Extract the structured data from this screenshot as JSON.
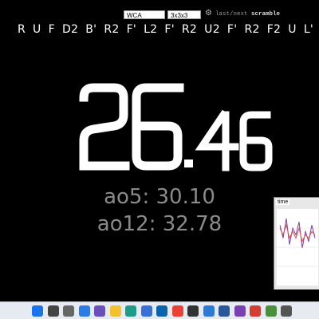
{
  "toolbar": {
    "event_type": "WCA",
    "puzzle": "3x3x3",
    "nav_prefix": "last/",
    "nav_next": "next",
    "nav_scramble": "scramble"
  },
  "scramble": {
    "moves": [
      "R",
      "U",
      "F",
      "D2",
      "B'",
      "R2",
      "F'",
      "L2",
      "F'",
      "R2",
      "U2",
      "F'",
      "R2",
      "F2",
      "U",
      "L'",
      "U"
    ]
  },
  "timer": {
    "int_part": "26",
    "dot": ".",
    "frac_part": "46"
  },
  "stats": {
    "ao5": "ao5: 30.10",
    "ao12": "ao12: 32.78"
  },
  "graph": {
    "title": "time",
    "series": [
      {
        "name": "",
        "color": "#7b3fa0",
        "values": [
          34,
          30,
          36,
          28,
          33,
          31,
          35,
          27,
          32,
          29,
          34,
          30
        ]
      },
      {
        "name": "",
        "color": "#e0504a",
        "values": [
          33,
          31,
          34,
          30,
          32,
          30,
          33,
          29,
          31,
          30,
          32,
          31
        ]
      }
    ]
  },
  "taskbar": {
    "icons": [
      "windows-icon",
      "search-icon",
      "task-view-icon",
      "widgets-icon",
      "chat-icon",
      "explorer-icon",
      "edge-icon",
      "store-icon",
      "mail-icon",
      "chrome-icon",
      "terminal-icon",
      "calendar-icon",
      "word-icon",
      "app-icon-1",
      "app-icon-2",
      "app-icon-3",
      "app-icon-4"
    ],
    "colors": {
      "windows": "#1a73e8",
      "edge": "#1f9b8a",
      "chrome": "#e94235",
      "word": "#2b579a",
      "explorer": "#f2c12e"
    }
  }
}
